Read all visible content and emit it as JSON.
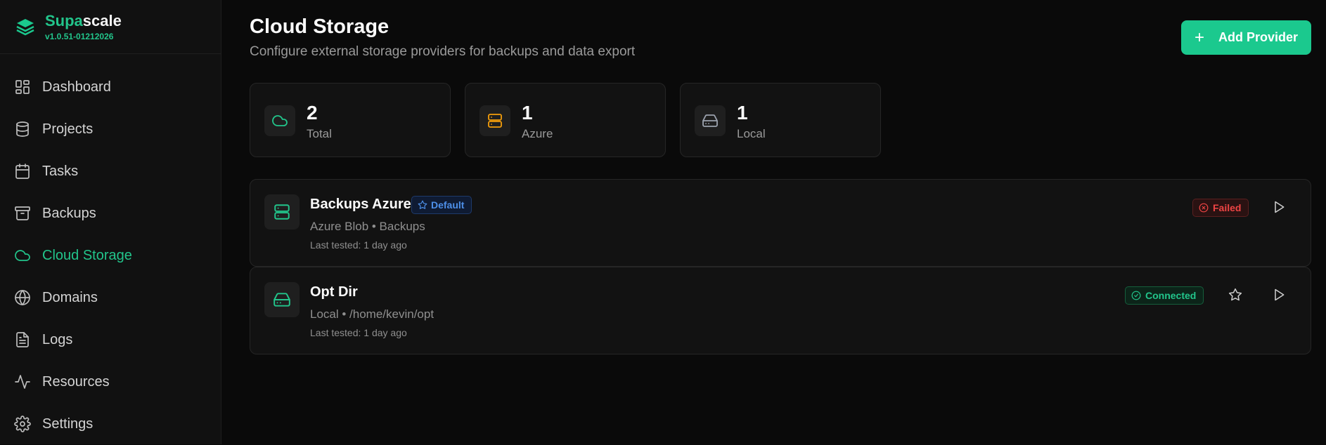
{
  "app": {
    "name_part1": "Supa",
    "name_part2": "scale",
    "version": "v1.0.51-01212026"
  },
  "sidebar": {
    "items": [
      {
        "label": "Dashboard",
        "icon": "dashboard-icon"
      },
      {
        "label": "Projects",
        "icon": "database-icon"
      },
      {
        "label": "Tasks",
        "icon": "calendar-icon"
      },
      {
        "label": "Backups",
        "icon": "archive-icon"
      },
      {
        "label": "Cloud Storage",
        "icon": "cloud-icon",
        "active": true
      },
      {
        "label": "Domains",
        "icon": "globe-icon"
      },
      {
        "label": "Logs",
        "icon": "file-text-icon"
      },
      {
        "label": "Resources",
        "icon": "activity-icon"
      },
      {
        "label": "Settings",
        "icon": "gear-icon"
      }
    ]
  },
  "header": {
    "title": "Cloud Storage",
    "subtitle": "Configure external storage providers for backups and data export",
    "add_button_label": "Add Provider"
  },
  "stats": [
    {
      "value": "2",
      "label": "Total",
      "icon": "cloud-icon",
      "color": "#22c58b"
    },
    {
      "value": "1",
      "label": "Azure",
      "icon": "server-icon",
      "color": "#f59e0b"
    },
    {
      "value": "1",
      "label": "Local",
      "icon": "hard-drive-icon",
      "color": "#9ca3af"
    }
  ],
  "providers": [
    {
      "name": "Backups Azure",
      "badge": "Default",
      "meta": "Azure Blob • Backups",
      "last_tested": "Last tested: 1 day ago",
      "status": "Failed",
      "icon": "server-icon"
    },
    {
      "name": "Opt Dir",
      "meta": "Local • /home/kevin/opt",
      "last_tested": "Last tested: 1 day ago",
      "status": "Connected",
      "icon": "hard-drive-icon"
    }
  ],
  "colors": {
    "accent": "#22c58b",
    "failed": "#ef4444",
    "default_badge": "#4d8fe8"
  }
}
